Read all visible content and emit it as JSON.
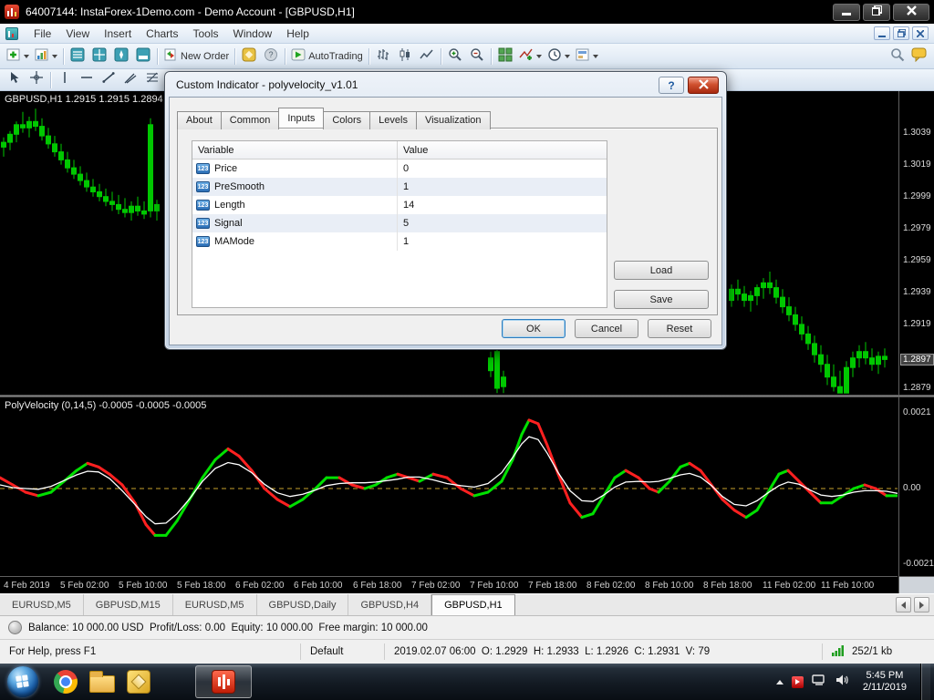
{
  "window": {
    "title": "64007144: InstaForex-1Demo.com - Demo Account - [GBPUSD,H1]"
  },
  "menu_bar": {
    "items": [
      "File",
      "View",
      "Insert",
      "Charts",
      "Tools",
      "Window",
      "Help"
    ]
  },
  "toolbar": {
    "new_order": "New Order",
    "autotrading": "AutoTrading"
  },
  "dialog": {
    "title": "Custom Indicator - polyvelocity_v1.01",
    "param_icon": "123",
    "tabs": [
      {
        "label": "About"
      },
      {
        "label": "Common"
      },
      {
        "label": "Inputs",
        "active": true
      },
      {
        "label": "Colors"
      },
      {
        "label": "Levels"
      },
      {
        "label": "Visualization"
      }
    ],
    "table": {
      "headers": [
        "Variable",
        "Value"
      ],
      "rows": [
        {
          "variable": "Price",
          "value": "0"
        },
        {
          "variable": "PreSmooth",
          "value": "1"
        },
        {
          "variable": "Length",
          "value": "14"
        },
        {
          "variable": "Signal",
          "value": "5"
        },
        {
          "variable": "MAMode",
          "value": "1"
        }
      ]
    },
    "buttons": {
      "load": "Load",
      "save": "Save",
      "ok": "OK",
      "cancel": "Cancel",
      "reset": "Reset"
    }
  },
  "chart": {
    "info_line": "GBPUSD,H1 1.2915 1.2915 1.2894 1.",
    "price_labels": [
      {
        "text": "1.3039",
        "price": 1.3039
      },
      {
        "text": "1.3019",
        "price": 1.3019
      },
      {
        "text": "1.2999",
        "price": 1.2999
      },
      {
        "text": "1.2979",
        "price": 1.2979
      },
      {
        "text": "1.2959",
        "price": 1.2959
      },
      {
        "text": "1.2939",
        "price": 1.2939
      },
      {
        "text": "1.2919",
        "price": 1.2919
      },
      {
        "text": "1.2897",
        "price": 1.2897,
        "current": true
      },
      {
        "text": "1.2879",
        "price": 1.2879
      }
    ]
  },
  "indicator_panel": {
    "label": "PolyVelocity (0,14,5) -0.0005 -0.0005 -0.0005",
    "scale_labels": [
      {
        "text": "0.0021",
        "value": 0.0021
      },
      {
        "text": "0.00",
        "value": 0
      },
      {
        "text": "-0.0021",
        "value": -0.0021
      }
    ]
  },
  "time_axis": {
    "labels": [
      "4 Feb 2019",
      "5 Feb 02:00",
      "5 Feb 10:00",
      "5 Feb 18:00",
      "6 Feb 02:00",
      "6 Feb 10:00",
      "6 Feb 18:00",
      "7 Feb 02:00",
      "7 Feb 10:00",
      "7 Feb 18:00",
      "8 Feb 02:00",
      "8 Feb 10:00",
      "8 Feb 18:00",
      "11 Feb 02:00",
      "11 Feb 10:00"
    ]
  },
  "chart_tabs": {
    "tabs": [
      {
        "label": "EURUSD,M5"
      },
      {
        "label": "GBPUSD,M15"
      },
      {
        "label": "EURUSD,M5"
      },
      {
        "label": "GBPUSD,Daily"
      },
      {
        "label": "GBPUSD,H4"
      },
      {
        "label": "GBPUSD,H1",
        "active": true
      }
    ]
  },
  "account_bar": {
    "text": "Balance: 10 000.00 USD  Profit/Loss: 0.00  Equity: 10 000.00  Free margin: 10 000.00"
  },
  "status_bar": {
    "help": "For Help, press F1",
    "profile": "Default",
    "quote": "2019.02.07 06:00  O: 1.2929  H: 1.2933  L: 1.2926  C: 1.2931  V: 79",
    "traffic": "252/1 kb"
  },
  "taskbar": {
    "clock_time": "5:45 PM",
    "clock_date": "2/11/2019"
  },
  "chart_data": {
    "type": "candlestick",
    "symbol": "GBPUSD",
    "timeframe": "H1",
    "price_axis_range": [
      1.2875,
      1.3065
    ],
    "candle_color": "#00c800",
    "candles": [
      [
        4,
        1.303,
        1.3036,
        1.3024,
        1.3033
      ],
      [
        11,
        1.3033,
        1.304,
        1.3028,
        1.3038
      ],
      [
        18,
        1.3038,
        1.3046,
        1.3033,
        1.3044
      ],
      [
        25,
        1.3044,
        1.3052,
        1.3039,
        1.3042
      ],
      [
        32,
        1.3042,
        1.3049,
        1.3036,
        1.3046
      ],
      [
        39,
        1.3046,
        1.3054,
        1.304,
        1.3043
      ],
      [
        46,
        1.3043,
        1.3048,
        1.3034,
        1.3037
      ],
      [
        53,
        1.3037,
        1.3042,
        1.3029,
        1.3032
      ],
      [
        60,
        1.3032,
        1.3037,
        1.3024,
        1.3027
      ],
      [
        67,
        1.3027,
        1.3032,
        1.3019,
        1.3022
      ],
      [
        74,
        1.3022,
        1.3027,
        1.3014,
        1.3017
      ],
      [
        81,
        1.3017,
        1.3022,
        1.301,
        1.3013
      ],
      [
        88,
        1.3013,
        1.3018,
        1.3006,
        1.3009
      ],
      [
        95,
        1.3009,
        1.3014,
        1.3002,
        1.3005
      ],
      [
        102,
        1.3005,
        1.301,
        1.2999,
        1.3002
      ],
      [
        109,
        1.3002,
        1.3007,
        1.2996,
        1.2999
      ],
      [
        116,
        1.2999,
        1.3004,
        1.2993,
        1.2996
      ],
      [
        123,
        1.2996,
        1.3002,
        1.299,
        1.2994
      ],
      [
        130,
        1.2994,
        1.3,
        1.2988,
        1.2991
      ],
      [
        137,
        1.2991,
        1.2998,
        1.2986,
        1.2989
      ],
      [
        144,
        1.2989,
        1.2996,
        1.2984,
        1.2993
      ],
      [
        151,
        1.2993,
        1.2999,
        1.2987,
        1.299
      ],
      [
        158,
        1.299,
        1.2996,
        1.2985,
        1.2988
      ],
      [
        165,
        1.3044,
        1.3048,
        1.2986,
        1.299
      ],
      [
        172,
        1.299,
        1.2997,
        1.2984,
        1.2994
      ],
      [
        538,
        1.2898,
        1.2902,
        1.2886,
        1.289
      ],
      [
        545,
        1.2902,
        1.2906,
        1.2876,
        1.2879
      ],
      [
        552,
        1.288,
        1.289,
        1.2876,
        1.2886
      ],
      [
        802,
        1.2934,
        1.2944,
        1.293,
        1.2941
      ],
      [
        809,
        1.2941,
        1.2947,
        1.2934,
        1.2938
      ],
      [
        816,
        1.2938,
        1.2943,
        1.293,
        1.2934
      ],
      [
        823,
        1.2934,
        1.294,
        1.2927,
        1.2937
      ],
      [
        830,
        1.2937,
        1.2944,
        1.2931,
        1.2942
      ],
      [
        837,
        1.2942,
        1.2948,
        1.2935,
        1.2945
      ],
      [
        844,
        1.2945,
        1.2952,
        1.2938,
        1.2942
      ],
      [
        851,
        1.2942,
        1.2947,
        1.2932,
        1.2936
      ],
      [
        858,
        1.2936,
        1.2941,
        1.2926,
        1.293
      ],
      [
        865,
        1.293,
        1.2936,
        1.2921,
        1.2925
      ],
      [
        872,
        1.2925,
        1.293,
        1.2915,
        1.2919
      ],
      [
        879,
        1.2919,
        1.2924,
        1.2909,
        1.2913
      ],
      [
        886,
        1.2913,
        1.2918,
        1.2903,
        1.2907
      ],
      [
        893,
        1.2907,
        1.2912,
        1.2895,
        1.29
      ],
      [
        900,
        1.29,
        1.2906,
        1.2889,
        1.2894
      ],
      [
        907,
        1.2894,
        1.29,
        1.2881,
        1.2886
      ],
      [
        914,
        1.2886,
        1.2894,
        1.2877,
        1.288
      ],
      [
        921,
        1.288,
        1.289,
        1.2876,
        1.2876
      ],
      [
        928,
        1.2876,
        1.2896,
        1.2876,
        1.2892
      ],
      [
        935,
        1.2892,
        1.2902,
        1.2886,
        1.2898
      ],
      [
        942,
        1.2898,
        1.2906,
        1.2892,
        1.2902
      ],
      [
        949,
        1.2902,
        1.2908,
        1.2894,
        1.2898
      ],
      [
        956,
        1.2898,
        1.2904,
        1.289,
        1.2894
      ],
      [
        963,
        1.2894,
        1.2902,
        1.2888,
        1.2899
      ],
      [
        970,
        1.2899,
        1.2904,
        1.2892,
        1.2897
      ]
    ],
    "oscillator": {
      "name": "PolyVelocity",
      "unit": 0.0001,
      "axis_range": [
        -0.0021,
        0.0021
      ],
      "zero_line": 0,
      "up_color": "#00e000",
      "down_color": "#ff2020",
      "signal_color": "#ffffff",
      "zero_color": "#c8a22c",
      "points": [
        [
          0,
          3
        ],
        [
          14,
          1
        ],
        [
          28,
          -1
        ],
        [
          42,
          -2
        ],
        [
          56,
          -1
        ],
        [
          70,
          2
        ],
        [
          84,
          5
        ],
        [
          96,
          7
        ],
        [
          108,
          6
        ],
        [
          120,
          4
        ],
        [
          134,
          1
        ],
        [
          148,
          -4
        ],
        [
          160,
          -10
        ],
        [
          170,
          -13
        ],
        [
          182,
          -13
        ],
        [
          194,
          -9
        ],
        [
          208,
          -3
        ],
        [
          222,
          3
        ],
        [
          236,
          8
        ],
        [
          250,
          11
        ],
        [
          262,
          9
        ],
        [
          276,
          5
        ],
        [
          290,
          0
        ],
        [
          304,
          -3
        ],
        [
          318,
          -5
        ],
        [
          332,
          -3
        ],
        [
          346,
          0
        ],
        [
          358,
          3
        ],
        [
          372,
          3
        ],
        [
          386,
          1
        ],
        [
          400,
          0
        ],
        [
          412,
          1
        ],
        [
          424,
          3
        ],
        [
          436,
          4
        ],
        [
          448,
          3
        ],
        [
          460,
          2
        ],
        [
          475,
          4
        ],
        [
          490,
          3
        ],
        [
          505,
          0
        ],
        [
          520,
          -2
        ],
        [
          535,
          -1
        ],
        [
          550,
          2
        ],
        [
          562,
          8
        ],
        [
          572,
          15
        ],
        [
          580,
          19
        ],
        [
          590,
          18
        ],
        [
          600,
          12
        ],
        [
          612,
          4
        ],
        [
          625,
          -4
        ],
        [
          638,
          -8
        ],
        [
          650,
          -7
        ],
        [
          662,
          -2
        ],
        [
          674,
          3
        ],
        [
          686,
          5
        ],
        [
          700,
          3
        ],
        [
          712,
          0
        ],
        [
          722,
          -1
        ],
        [
          734,
          2
        ],
        [
          746,
          6
        ],
        [
          756,
          7
        ],
        [
          768,
          5
        ],
        [
          780,
          1
        ],
        [
          792,
          -3
        ],
        [
          805,
          -6
        ],
        [
          818,
          -8
        ],
        [
          830,
          -6
        ],
        [
          842,
          -1
        ],
        [
          854,
          4
        ],
        [
          864,
          5
        ],
        [
          876,
          2
        ],
        [
          888,
          -1
        ],
        [
          900,
          -4
        ],
        [
          912,
          -4
        ],
        [
          924,
          -2
        ],
        [
          936,
          0
        ],
        [
          948,
          1
        ],
        [
          960,
          0
        ],
        [
          972,
          -2
        ],
        [
          984,
          -2
        ]
      ]
    }
  }
}
